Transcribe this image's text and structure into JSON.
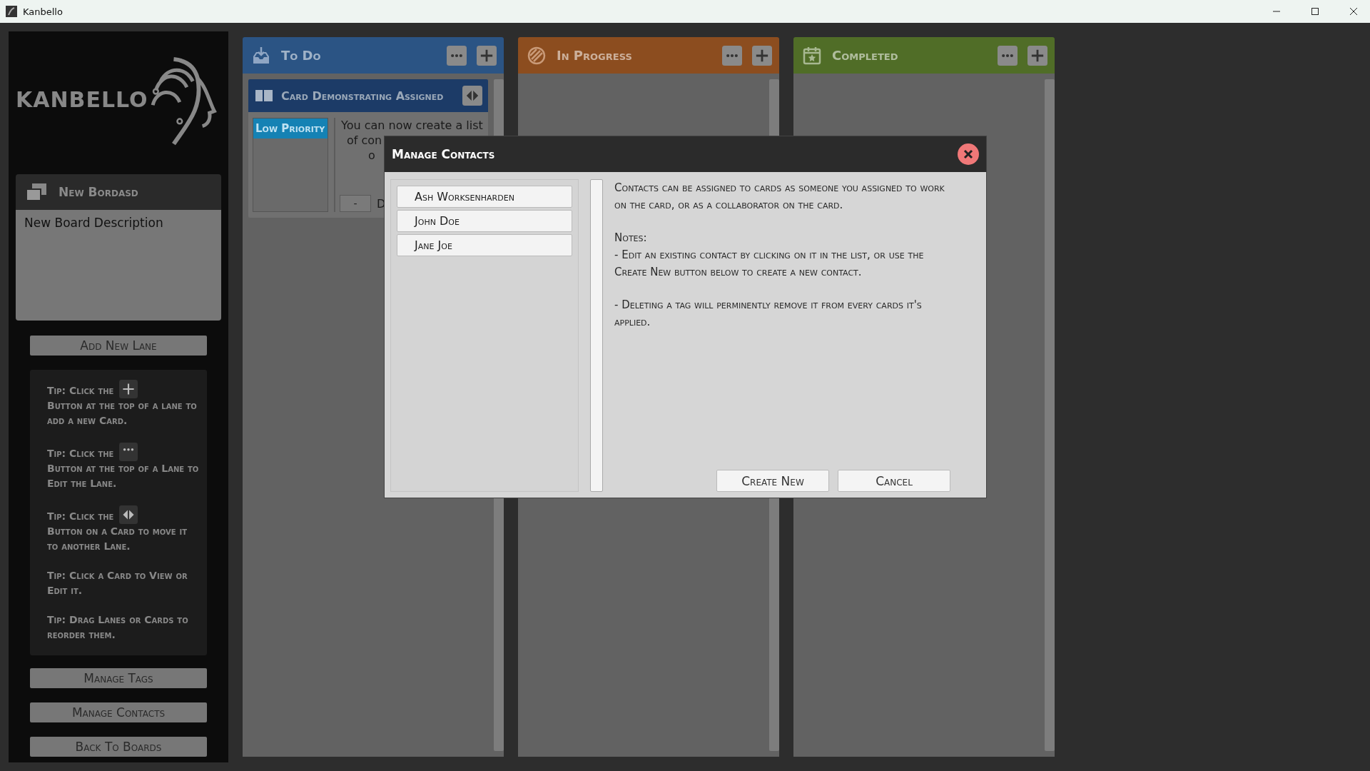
{
  "window": {
    "title": "Kanbello"
  },
  "sidebar": {
    "logo_text": "KANBELLO",
    "board": {
      "title": "New Bordasd",
      "description": "New Board Description"
    },
    "add_lane_button": "Add New Lane",
    "tips": [
      {
        "lead": "Tip: Click the",
        "rest": "Button at the top of a lane to add a new Card."
      },
      {
        "lead": "Tip: Click the",
        "rest": "Button at the top of a Lane to Edit the Lane."
      },
      {
        "lead": "Tip: Click the",
        "rest": "Button on a Card to move it to another Lane."
      },
      {
        "lead": "Tip: Click a Card to View or Edit it."
      },
      {
        "lead": "Tip: Drag Lanes or Cards to reorder them."
      }
    ],
    "buttons": [
      "Manage Tags",
      "Manage Contacts",
      "Back To Boards"
    ]
  },
  "lanes": [
    {
      "title": "To Do",
      "color": "#2b5484",
      "cards": [
        {
          "title": "Card Demonstrating Assigned",
          "tag": "Low Priority",
          "text_lines": [
            "You can now create a list",
            "of con",
            "o"
          ],
          "footer_button": "-",
          "footer_text": "D"
        }
      ]
    },
    {
      "title": "In Progress",
      "color": "#8c4d1f"
    },
    {
      "title": "Completed",
      "color": "#506d27"
    }
  ],
  "dialog": {
    "title": "Manage Contacts",
    "contacts": [
      "Ash Worksenharden",
      "John Doe",
      "Jane Joe"
    ],
    "paragraphs": [
      [
        "Contacts can be assigned to cards as someone you assigned to work on the card, or as a collaborator on the card."
      ],
      [
        "Notes:",
        "- Edit an existing contact by clicking on it in the list, or use the Create New button below to create a new contact."
      ],
      [
        "- Deleting a tag will perminently remove it from every cards it's applied."
      ]
    ],
    "buttons": [
      "Create New",
      "Cancel"
    ]
  }
}
